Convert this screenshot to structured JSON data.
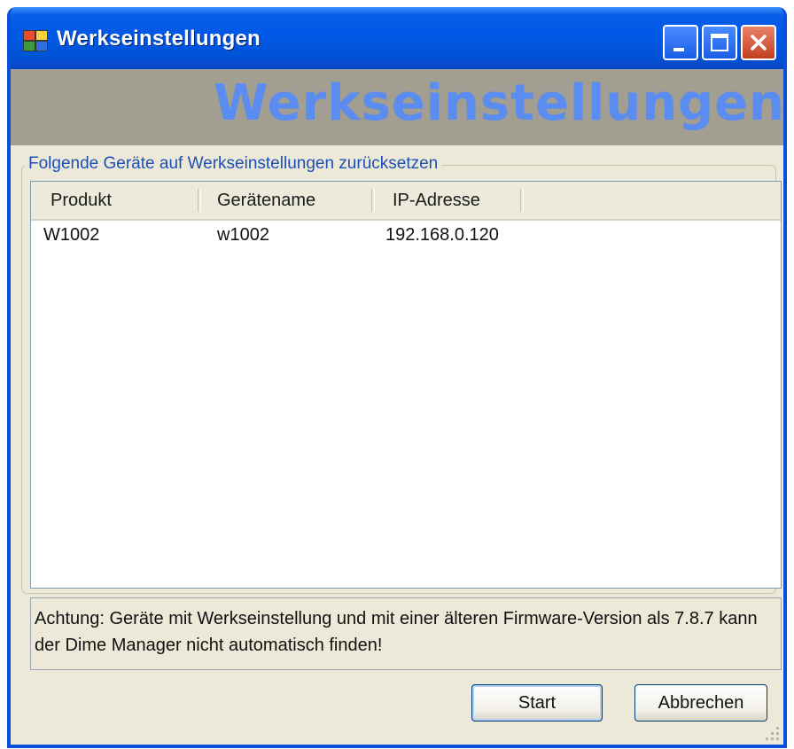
{
  "window": {
    "title": "Werkseinstellungen"
  },
  "banner": {
    "text": "Werkseinstellungen"
  },
  "group": {
    "legend": "Folgende Geräte auf Werkseinstellungen zurücksetzen"
  },
  "list": {
    "columns": [
      "Produkt",
      "Gerätename",
      "IP-Adresse"
    ],
    "rows": [
      [
        "W1002",
        "w1002",
        "192.168.0.120"
      ]
    ]
  },
  "note": {
    "text": "Achtung: Geräte mit Werkseinstellung und mit einer älteren Firmware-Version als 7.8.7 kann der Dime Manager nicht automatisch finden!"
  },
  "buttons": {
    "start": "Start",
    "cancel": "Abbrechen"
  },
  "colors": {
    "titlebar": "#0058e6",
    "banner_bg": "#a29e92",
    "banner_text": "#5b8cf0",
    "legend": "#1d4fb8",
    "dialog_bg": "#ece9d8"
  },
  "icons": {
    "app": "app-window-icon",
    "minimize": "minimize-icon",
    "maximize": "maximize-icon",
    "close": "close-icon"
  }
}
